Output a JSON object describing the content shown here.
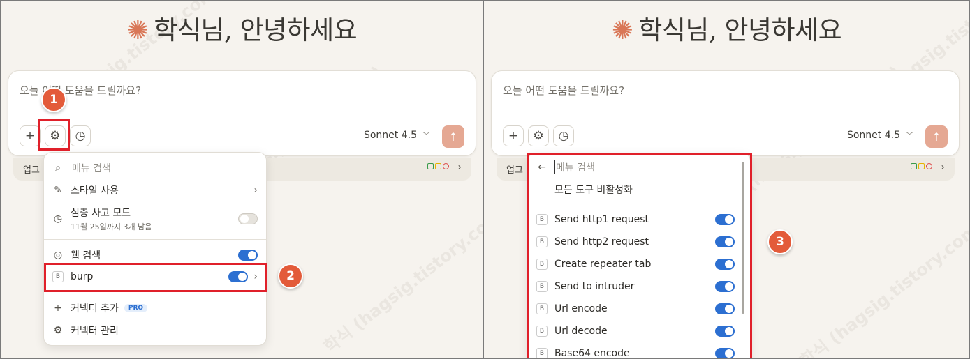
{
  "greeting": "학식님, 안녕하세요",
  "composer": {
    "placeholder": "오늘 어떤 도움을 드릴까요?",
    "model": "Sonnet 4.5"
  },
  "upgrade_text": "업그",
  "left_menu": {
    "search_placeholder": "메뉴 검색",
    "items": [
      {
        "label": "스타일 사용"
      },
      {
        "label": "심층 사고 모드",
        "sub": "11월 25일까지 3개 남음"
      },
      {
        "label": "웹 검색"
      },
      {
        "label": "burp"
      },
      {
        "label": "커넥터 추가",
        "badge": "PRO"
      },
      {
        "label": "커넥터 관리"
      }
    ]
  },
  "right_menu": {
    "search_placeholder": "메뉴 검색",
    "disable_all": "모든 도구 비활성화",
    "tools": [
      "Send http1 request",
      "Send http2 request",
      "Create repeater tab",
      "Send to intruder",
      "Url encode",
      "Url decode",
      "Base64 encode"
    ]
  },
  "callouts": [
    "1",
    "2",
    "3"
  ],
  "watermark": "학식 (hagsig.tistory.com)",
  "colors": {
    "accent": "#d97757",
    "toggle_on": "#2c6fd1",
    "highlight": "#e0202a",
    "callout": "#e35b3a"
  }
}
